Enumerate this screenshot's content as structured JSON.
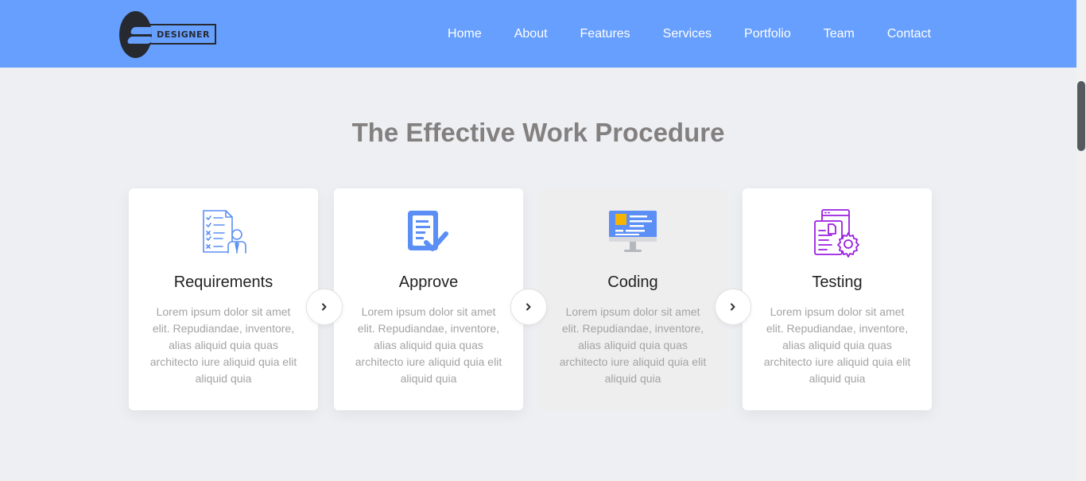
{
  "logo": {
    "text": "DESIGNER"
  },
  "nav": {
    "items": [
      "Home",
      "About",
      "Features",
      "Services",
      "Portfolio",
      "Team",
      "Contact"
    ]
  },
  "section": {
    "title": "The Effective Work Procedure"
  },
  "cards": [
    {
      "title": "Requirements",
      "icon": "requirements-checklist-icon",
      "description": "Lorem ipsum dolor sit amet elit. Repudiandae, inventore, alias aliquid quia quas architecto iure aliquid quia elit aliquid quia"
    },
    {
      "title": "Approve",
      "icon": "approve-document-icon",
      "description": "Lorem ipsum dolor sit amet elit. Repudiandae, inventore, alias aliquid quia quas architecto iure aliquid quia elit aliquid quia"
    },
    {
      "title": "Coding",
      "icon": "coding-monitor-icon",
      "description": "Lorem ipsum dolor sit amet elit. Repudiandae, inventore, alias aliquid quia quas architecto iure aliquid quia elit aliquid quia"
    },
    {
      "title": "Testing",
      "icon": "testing-gear-icon",
      "description": "Lorem ipsum dolor sit amet elit. Repudiandae, inventore, alias aliquid quia quas architecto iure aliquid quia elit aliquid quia"
    }
  ],
  "colors": {
    "header": "#679ffe",
    "background": "#edeff3",
    "title": "#83807f",
    "icon_blue": "#5b8ff5",
    "icon_purple": "#9b1fe0"
  }
}
